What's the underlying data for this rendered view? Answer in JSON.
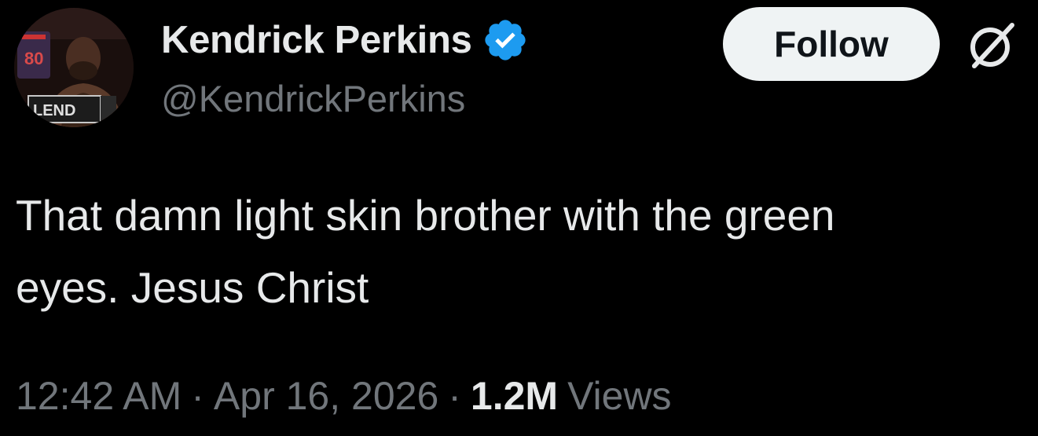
{
  "author": {
    "display_name": "Kendrick Perkins",
    "handle": "@KendrickPerkins",
    "verified": true,
    "verified_color": "#1d9bf0",
    "avatar_jersey_number": "80",
    "avatar_sign_text": "LEND"
  },
  "actions": {
    "follow_label": "Follow",
    "grok_icon": "grok-icon"
  },
  "tweet": {
    "text": "That damn light skin brother with the green\neyes. Jesus Christ"
  },
  "meta": {
    "time": "12:42 AM",
    "separator": "·",
    "date": "Apr 16, 2026",
    "views_count": "1.2M",
    "views_label": "Views"
  },
  "colors": {
    "background": "#000000",
    "primary_text": "#e7e9ea",
    "secondary_text": "#71767b",
    "follow_bg": "#eff3f4"
  }
}
